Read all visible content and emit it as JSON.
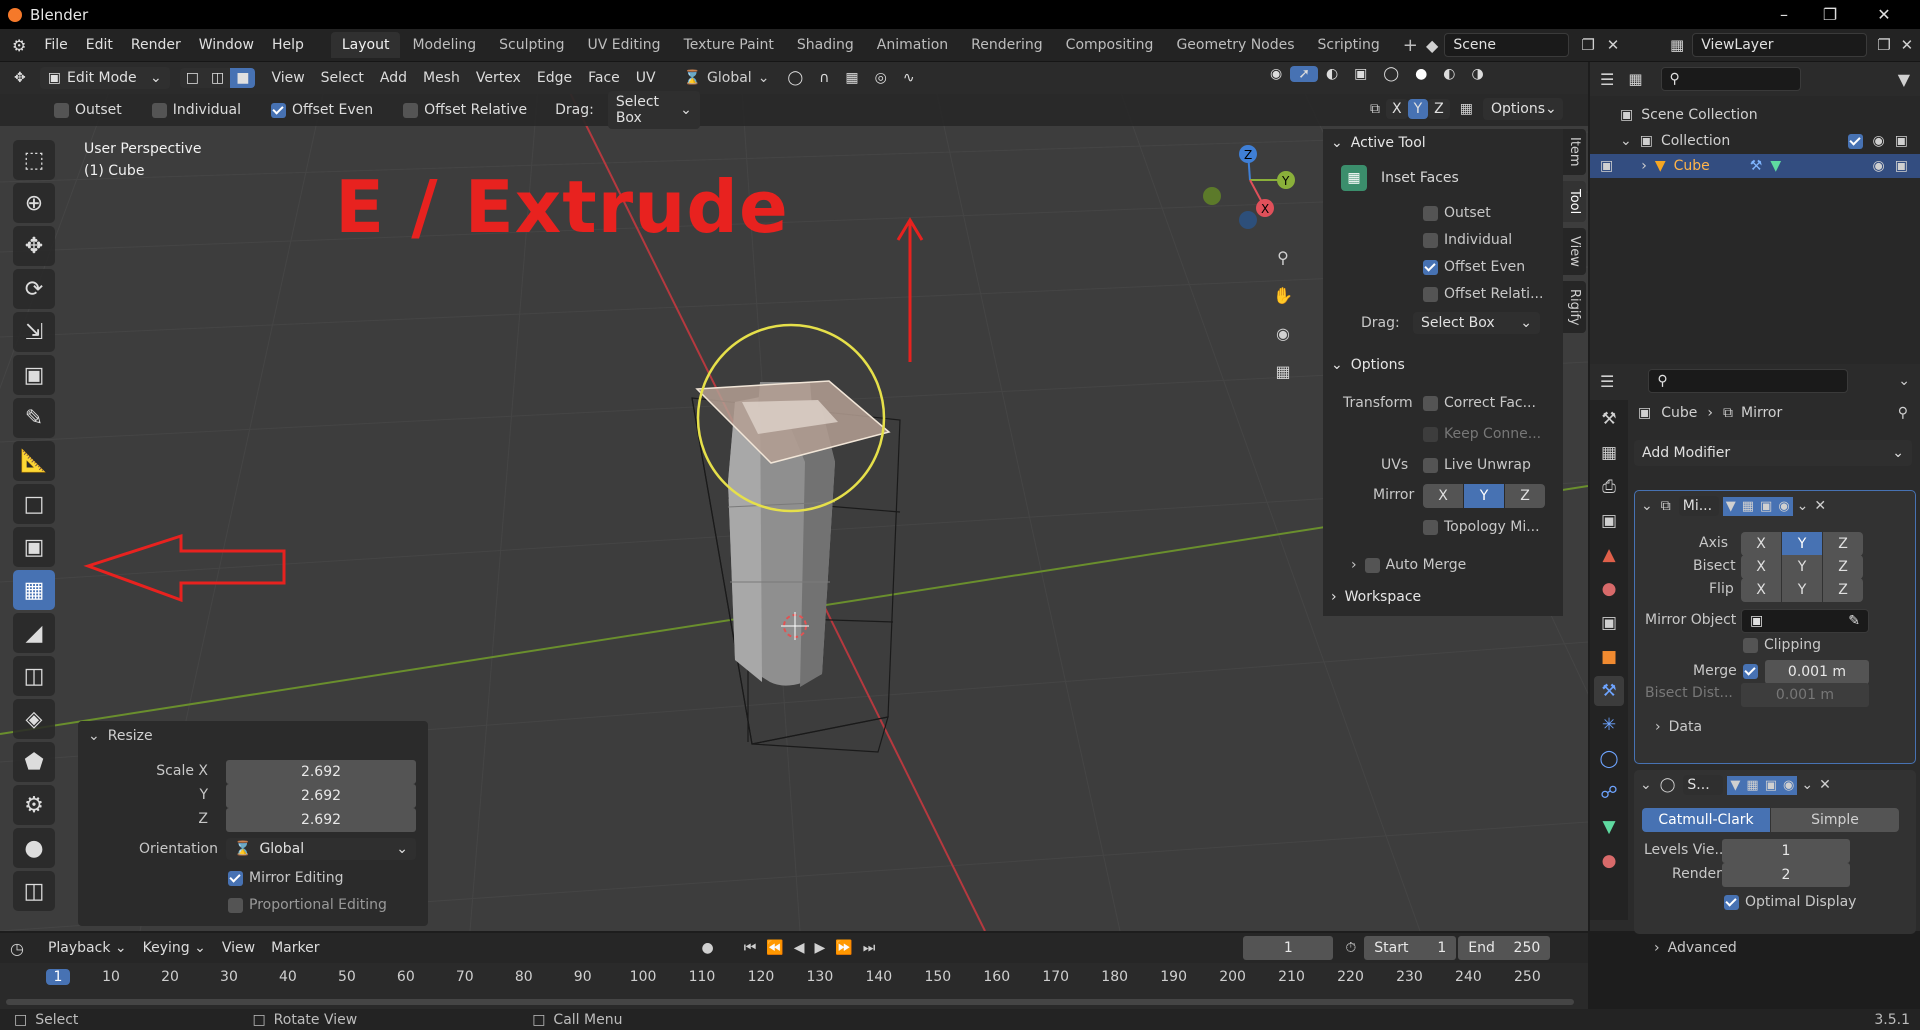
{
  "app": {
    "title": "Blender",
    "version": "3.5.1"
  },
  "menu": [
    "File",
    "Edit",
    "Render",
    "Window",
    "Help"
  ],
  "workspaces": [
    "Layout",
    "Modeling",
    "Sculpting",
    "UV Editing",
    "Texture Paint",
    "Shading",
    "Animation",
    "Rendering",
    "Compositing",
    "Geometry Nodes",
    "Scripting"
  ],
  "active_workspace": "Layout",
  "scene": "Scene",
  "view_layer": "ViewLayer",
  "viewport_header": {
    "mode": "Edit Mode",
    "menus": [
      "View",
      "Select",
      "Add",
      "Mesh",
      "Vertex",
      "Edge",
      "Face",
      "UV"
    ],
    "orientation": "Global"
  },
  "tool_settings": {
    "outset": "Outset",
    "individual": "Individual",
    "offset_even": "Offset Even",
    "offset_relative": "Offset Relative",
    "drag_label": "Drag:",
    "drag_value": "Select Box",
    "options": "Options",
    "axes": [
      "X",
      "Y",
      "Z"
    ]
  },
  "viewport": {
    "perspective": "User Perspective",
    "object": "(1) Cube",
    "annotation": "E / Extrude"
  },
  "npanel": {
    "tabs": [
      "Item",
      "Tool",
      "View",
      "Rigify"
    ],
    "active_tool_header": "Active Tool",
    "tool_name": "Inset Faces",
    "outset": "Outset",
    "individual": "Individual",
    "offset_even": "Offset Even",
    "offset_relative": "Offset Relati...",
    "drag_label": "Drag:",
    "drag_value": "Select Box",
    "options_header": "Options",
    "transform_label": "Transform",
    "correct_face": "Correct Fac...",
    "keep_connected": "Keep Conne...",
    "uvs_label": "UVs",
    "live_unwrap": "Live Unwrap",
    "mirror_label": "Mirror",
    "mirror_axes": [
      "X",
      "Y",
      "Z"
    ],
    "topology_mirror": "Topology Mi...",
    "auto_merge": "Auto Merge",
    "workspace": "Workspace"
  },
  "redo_panel": {
    "title": "Resize",
    "scale_x_label": "Scale X",
    "y_label": "Y",
    "z_label": "Z",
    "scale_x": "2.692",
    "scale_y": "2.692",
    "scale_z": "2.692",
    "orientation_label": "Orientation",
    "orientation_value": "Global",
    "mirror_editing": "Mirror Editing",
    "proportional_editing": "Proportional Editing"
  },
  "outliner": {
    "scene_collection": "Scene Collection",
    "collection": "Collection",
    "object": "Cube"
  },
  "properties": {
    "breadcrumb_object": "Cube",
    "breadcrumb_modifier": "Mirror",
    "add_modifier": "Add Modifier",
    "mirror": {
      "name": "Mi...",
      "axis_label": "Axis",
      "bisect_label": "Bisect",
      "flip_label": "Flip",
      "axes": [
        "X",
        "Y",
        "Z"
      ],
      "mirror_object_label": "Mirror Object",
      "clipping": "Clipping",
      "merge_label": "Merge",
      "merge_value": "0.001 m",
      "bisect_dist_label": "Bisect Dist...",
      "bisect_dist_value": "0.001 m",
      "data": "Data"
    },
    "subsurf": {
      "name": "S...",
      "catmull": "Catmull-Clark",
      "simple": "Simple",
      "levels_label": "Levels Vie...",
      "levels_value": "1",
      "render_label": "Render",
      "render_value": "2",
      "optimal": "Optimal Display",
      "advanced": "Advanced"
    }
  },
  "timeline": {
    "playback": "Playback",
    "keying": "Keying",
    "view": "View",
    "marker": "Marker",
    "current_frame": "1",
    "start_label": "Start",
    "start": "1",
    "end_label": "End",
    "end": "250",
    "ticks": [
      "1",
      "10",
      "20",
      "30",
      "40",
      "50",
      "60",
      "70",
      "80",
      "90",
      "100",
      "110",
      "120",
      "130",
      "140",
      "150",
      "160",
      "170",
      "180",
      "190",
      "200",
      "210",
      "220",
      "230",
      "240",
      "250"
    ]
  },
  "statusbar": {
    "select": "Select",
    "rotate": "Rotate View",
    "call_menu": "Call Menu"
  },
  "colors": {
    "accent": "#4772b3",
    "annotation_red": "#e8221f",
    "selection_yellow": "#e6e04a",
    "viewport_bg": "#3d3d3d"
  }
}
